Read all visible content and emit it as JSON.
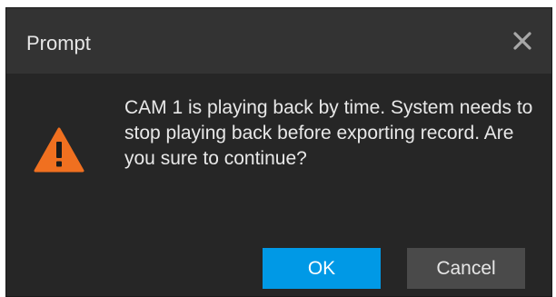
{
  "dialog": {
    "title": "Prompt",
    "icons": {
      "close": "close-icon",
      "warning": "warning-icon"
    },
    "message": "CAM 1 is playing back by time. System needs to stop playing back before exporting record. Are you sure to continue?",
    "buttons": {
      "ok_label": "OK",
      "cancel_label": "Cancel"
    }
  },
  "colors": {
    "dialog_bg": "#262626",
    "titlebar_bg": "#333333",
    "primary_button": "#0099e6",
    "secondary_button": "#4a4a4a",
    "warning": "#f07020"
  }
}
